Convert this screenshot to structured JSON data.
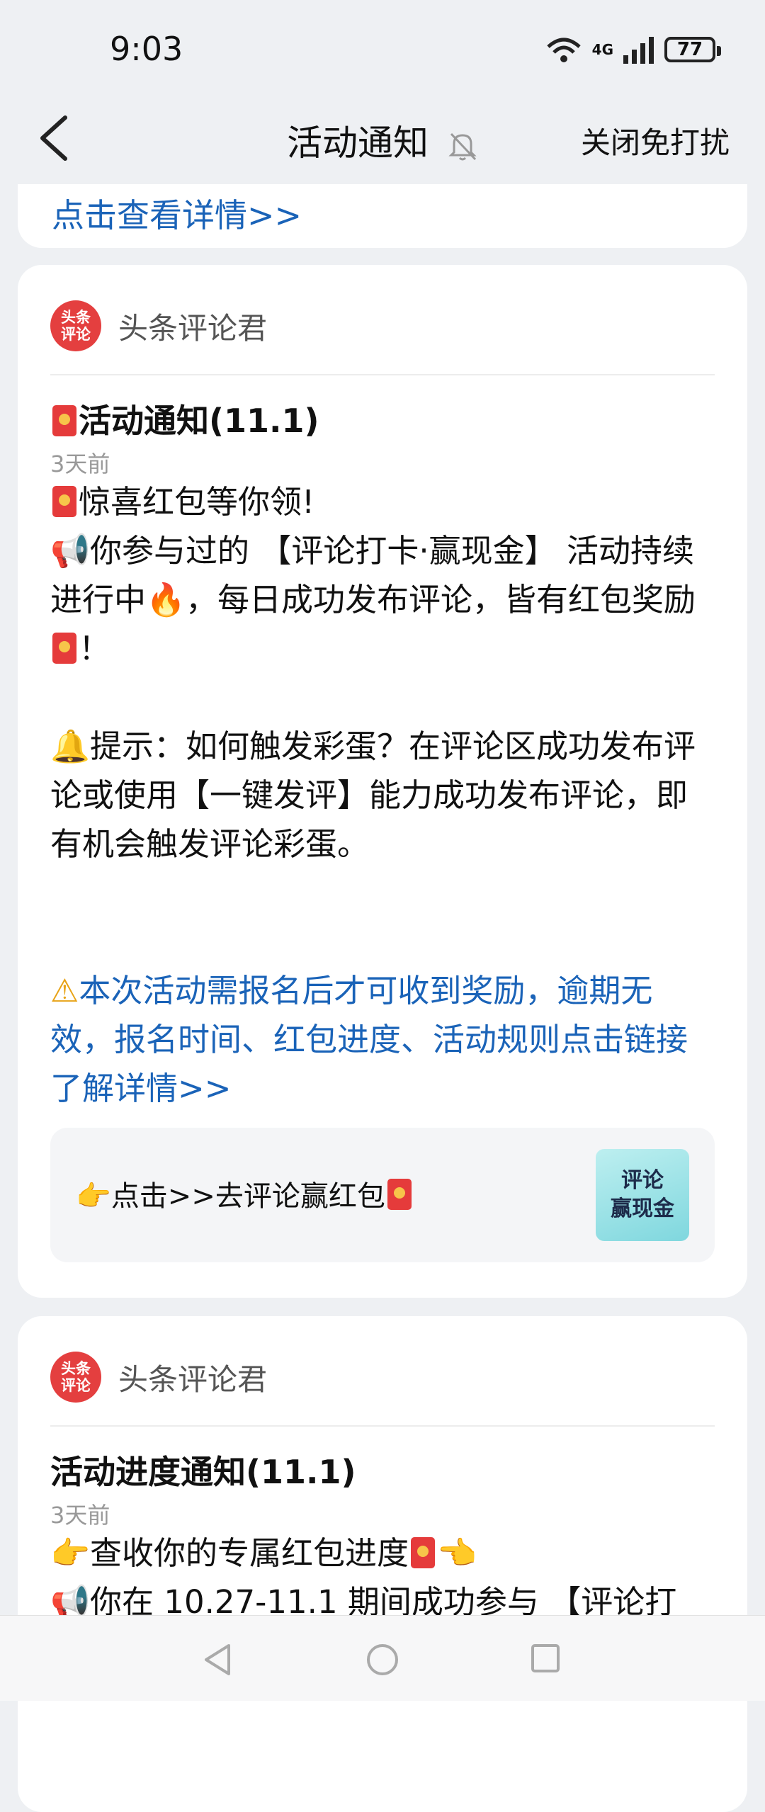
{
  "status": {
    "time": "9:03",
    "network": "4G",
    "battery": "77"
  },
  "nav": {
    "title": "活动通知",
    "dnd": "关闭免打扰"
  },
  "card0": {
    "link": "点击查看详情>>"
  },
  "card1": {
    "sender": "头条评论君",
    "logo": [
      "头条",
      "评论"
    ],
    "title": "活动通知(11.1)",
    "time": "3天前",
    "line1": "惊喜红包等你领!",
    "line2a": "你参与过的 【评论打卡·赢现金】 活动持续进行中",
    "line2b": "，每日成功发布评论，皆有红包奖励",
    "line2c": "！",
    "tip": "提示：如何触发彩蛋？在评论区成功发布评论或使用【一键发评】能力成功发布评论，即有机会触发评论彩蛋。",
    "notice": "本次活动需报名后才可收到奖励，逾期无效，报名时间、红包进度、活动规则点击链接了解详情>>",
    "action_text": "点击>>去评论赢红包",
    "thumb_label": [
      "评论",
      "赢现金"
    ]
  },
  "card2": {
    "sender": "头条评论君",
    "logo": [
      "头条",
      "评论"
    ],
    "title": "活动进度通知(11.1)",
    "time": "3天前",
    "line1": "查收你的专属红包进度",
    "line2": "你在 10.27-11.1 期间成功参与 【评论打"
  },
  "colors": {
    "link": "#1a63b8",
    "logo": "#e43f3f",
    "background": "#eef0f3"
  }
}
